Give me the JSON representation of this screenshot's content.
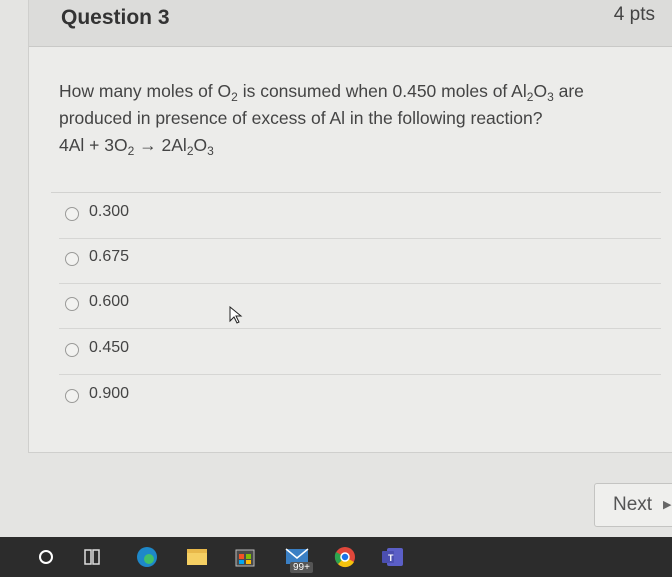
{
  "question": {
    "title": "Question 3",
    "points": "4 pts",
    "text_line1_part1": "How many moles of O",
    "text_line1_sub1": "2",
    "text_line1_part2": " is consumed when 0.450 moles of Al",
    "text_line1_sub2": "2",
    "text_line1_part3": "O",
    "text_line1_sub3": "3",
    "text_line1_part4": " are",
    "text_line2": "produced in presence of excess of Al in the following reaction?",
    "equation_part1": "4Al + 3O",
    "equation_sub1": "2",
    "equation_part2": " → 2Al",
    "equation_sub2": "2",
    "equation_part3": "O",
    "equation_sub3": "3"
  },
  "options": [
    {
      "label": "0.300"
    },
    {
      "label": "0.675"
    },
    {
      "label": "0.600"
    },
    {
      "label": "0.450"
    },
    {
      "label": "0.900"
    }
  ],
  "navigation": {
    "next_label": "Next"
  },
  "taskbar": {
    "icons": [
      "start-circle-icon",
      "task-view-icon",
      "edge-browser-icon",
      "file-explorer-icon",
      "store-icon",
      "mail-icon",
      "chrome-icon",
      "teams-icon"
    ],
    "mail_badge": "99+"
  }
}
